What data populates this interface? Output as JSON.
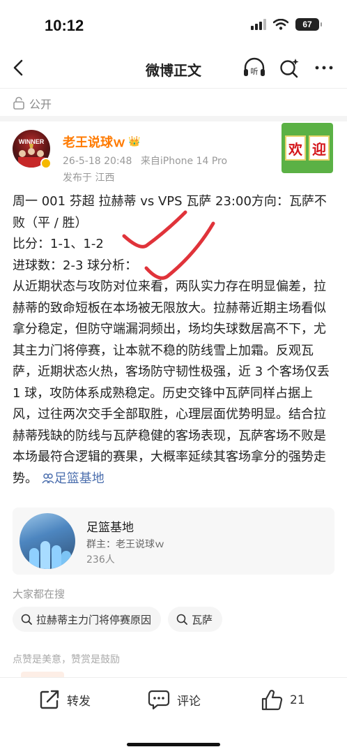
{
  "status_bar": {
    "time": "10:12",
    "battery": "67"
  },
  "nav": {
    "title": "微博正文",
    "listen_label": "听"
  },
  "visibility": {
    "label": "公开"
  },
  "author": {
    "name": "老王说球ｗ",
    "avatar_text": "WINNER",
    "posted_at": "26-5-18 20:48",
    "source": "来自iPhone 14 Pro",
    "location": "发布于 江西",
    "sticker": [
      "欢",
      "迎"
    ]
  },
  "post": {
    "lines": [
      "周一 001 芬超 拉赫蒂 vs VPS 瓦萨 23:00方向：瓦萨不败（平 / 胜）",
      "比分：1-1、1-2",
      "进球数：2-3 球分析：",
      "从近期状态与攻防对位来看，两队实力存在明显偏差，拉赫蒂的致命短板在本场被无限放大。拉赫蒂近期主场看似拿分稳定，但防守端漏洞频出，场均失球数居高不下，尤其主力门将停赛，让本就不稳的防线雪上加霜。反观瓦萨，近期状态火热，客场防守韧性极强，近 3 个客场仅丢 1 球，攻防体系成熟稳定。历史交锋中瓦萨同样占据上风，过往两次交手全部取胜，心理层面优势明显。结合拉赫蒂残缺的防线与瓦萨稳健的客场表现，瓦萨客场不败是本场最符合逻辑的赛果，大概率延续其客场拿分的强势走势。"
    ],
    "topic_link": "足篮基地",
    "annotation_color": "#e0333a"
  },
  "group": {
    "name": "足篮基地",
    "owner": "群主：老王说球ｗ",
    "members": "236人"
  },
  "searches": {
    "heading": "大家都在搜",
    "items": [
      "拉赫蒂主力门将停赛原因",
      "瓦萨"
    ]
  },
  "like_hint": "点赞是美意，赞赏是鼓励",
  "actions": {
    "repost": "转发",
    "comment": "评论",
    "like": "21"
  },
  "colors": {
    "author": "#ff7a00",
    "link": "#4c6fae",
    "muted": "#999999"
  }
}
